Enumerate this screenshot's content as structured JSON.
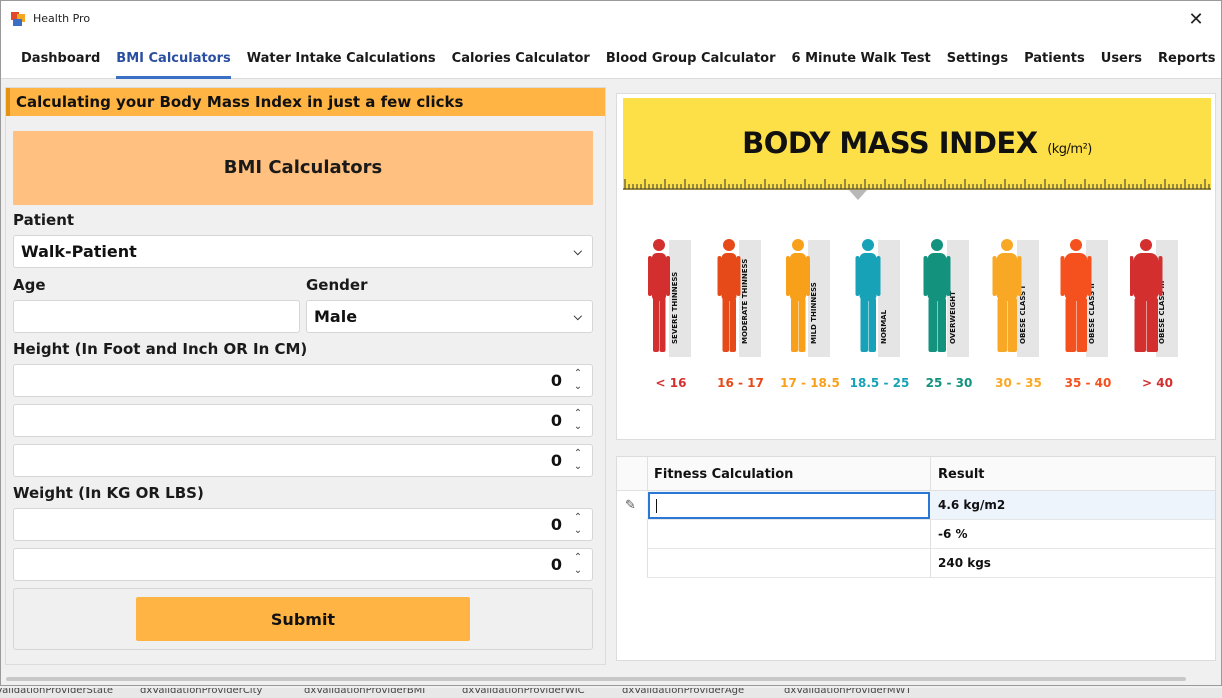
{
  "window": {
    "title": "Health Pro"
  },
  "tabs": [
    {
      "label": "Dashboard"
    },
    {
      "label": "BMI Calculators"
    },
    {
      "label": "Water Intake Calculations"
    },
    {
      "label": "Calories Calculator"
    },
    {
      "label": "Blood Group Calculator"
    },
    {
      "label": "6 Minute Walk Test"
    },
    {
      "label": "Settings"
    },
    {
      "label": "Patients"
    },
    {
      "label": "Users"
    },
    {
      "label": "Reports"
    }
  ],
  "active_tab": "BMI Calculators",
  "form": {
    "banner": "Calculating your Body Mass Index in just a few clicks",
    "card_title": "BMI Calculators",
    "patient_label": "Patient",
    "patient_value": "Walk-Patient",
    "age_label": "Age",
    "age_value": "",
    "gender_label": "Gender",
    "gender_value": "Male",
    "height_label": "Height (In Foot and Inch OR In CM)",
    "height_values": [
      "0",
      "0",
      "0"
    ],
    "weight_label": "Weight (In KG OR LBS)",
    "weight_values": [
      "0",
      "0"
    ],
    "submit_label": "Submit"
  },
  "bmi_chart": {
    "title": "BODY MASS INDEX",
    "unit": "(kg/m²)",
    "categories": [
      {
        "label": "SEVERE THINNESS",
        "range": "< 16",
        "color": "#d32f2f"
      },
      {
        "label": "MODERATE THINNESS",
        "range": "16 - 17",
        "color": "#e64a19"
      },
      {
        "label": "MILD THINNESS",
        "range": "17 - 18.5",
        "color": "#f9a01b"
      },
      {
        "label": "NORMAL",
        "range": "18.5 - 25",
        "color": "#17a2b8"
      },
      {
        "label": "OVERWEIGHT",
        "range": "25 - 30",
        "color": "#13927e"
      },
      {
        "label": "OBESE CLASS I",
        "range": "30 - 35",
        "color": "#f9a825"
      },
      {
        "label": "OBESE CLASS II",
        "range": "35 - 40",
        "color": "#f4511e"
      },
      {
        "label": "OBESE CLASS III",
        "range": "> 40",
        "color": "#d32f2f"
      }
    ]
  },
  "results": {
    "col_fitness": "Fitness Calculation",
    "col_result": "Result",
    "rows": [
      {
        "fitness": "",
        "result": "4.6 kg/m2"
      },
      {
        "fitness": "",
        "result": "-6 %"
      },
      {
        "fitness": "",
        "result": "240 kgs"
      }
    ]
  },
  "status_items": [
    "ValidationProviderState",
    "dxValidationProviderCity",
    "dxValidationProviderBMI",
    "dxValidationProviderWIC",
    "dxValidationProviderAge",
    "dxValidationProviderMWT"
  ]
}
